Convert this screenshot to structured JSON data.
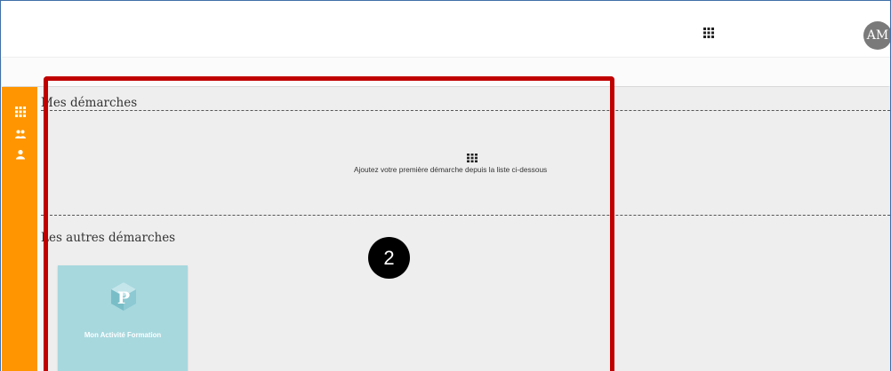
{
  "header": {
    "apps_icon": "apps-grid-icon",
    "user_initials": "AM"
  },
  "sidebar": {
    "items": [
      {
        "icon": "apps-grid-icon"
      },
      {
        "icon": "group-icon"
      },
      {
        "icon": "person-icon"
      }
    ]
  },
  "my_procedures": {
    "title": "Mes démarches",
    "empty_icon": "apps-grid-icon",
    "empty_message": "Ajoutez votre première démarche depuis la liste ci-dessous"
  },
  "other_procedures": {
    "title": "Les autres démarches",
    "cards": [
      {
        "label": "Mon Activité Formation",
        "logo": "p-logo-icon",
        "color": "#a7d8de"
      }
    ]
  },
  "annotation": {
    "callout_number": "2",
    "highlight_color": "#c00000"
  },
  "colors": {
    "sidebar": "#ff9500",
    "content_background": "#eeeeee"
  }
}
